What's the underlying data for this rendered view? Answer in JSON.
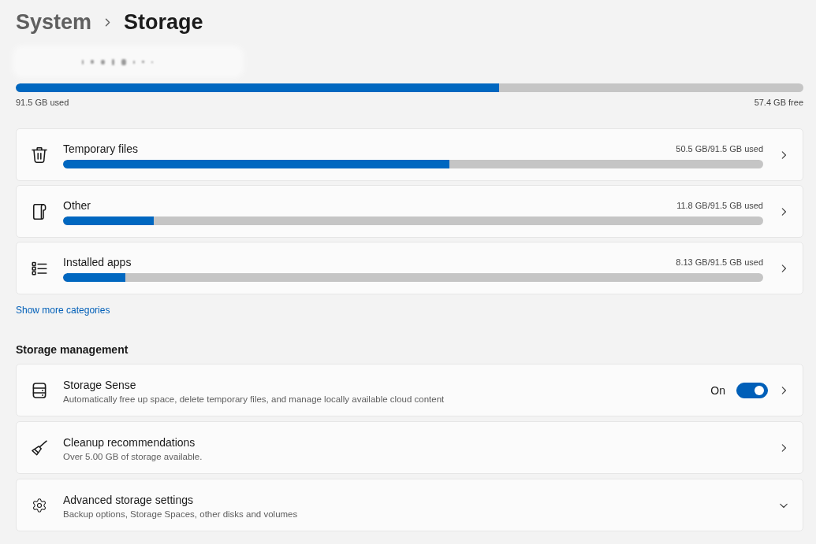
{
  "breadcrumb": [
    {
      "label": "System",
      "current": false
    },
    {
      "label": "Storage",
      "current": true
    }
  ],
  "drive": {
    "level": 0.614,
    "used": "91.5 GB used",
    "free": "57.4 GB free"
  },
  "categories": [
    {
      "label": "Temporary files",
      "reading": "50.5 GB/91.5 GB used",
      "level": 0.552
    },
    {
      "label": "Other",
      "reading": "11.8 GB/91.5 GB used",
      "level": 0.129
    },
    {
      "label": "Installed apps",
      "reading": "8.13 GB/91.5 GB used",
      "level": 0.089
    }
  ],
  "show_more_link": "Show more categories",
  "storage_management": {
    "heading": "Storage management",
    "items": [
      {
        "kind": "toggle",
        "title": "Storage Sense",
        "description": "Automatically free up space, delete temporary files, and manage locally available cloud content",
        "toggle": {
          "label": "On",
          "on": true
        }
      },
      {
        "kind": "link",
        "title": "Cleanup recommendations",
        "description": "Over 5.00 GB of storage available."
      },
      {
        "kind": "expander",
        "title": "Advanced storage settings",
        "description": "Backup options, Storage Spaces, other disks and volumes",
        "expanded": false
      }
    ]
  }
}
